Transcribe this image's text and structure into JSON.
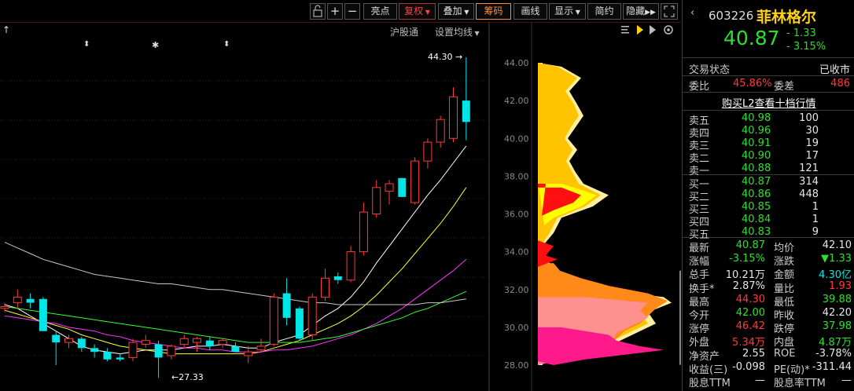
{
  "toolbar": {
    "liangdian": "亮点",
    "fuquan": "复权",
    "diejia": "叠加",
    "chouma": "筹码",
    "huaxian": "画线",
    "xianshi": "显示",
    "jianyue": "简约",
    "yincang": "隐藏"
  },
  "subbar": {
    "hugutong": "沪股通",
    "junxian": "设置均线"
  },
  "chart": {
    "high_label": "44.30",
    "low_label": "27.33",
    "yticks": [
      "44.00",
      "42.00",
      "40.00",
      "38.00",
      "36.00",
      "34.00",
      "32.00",
      "30.00",
      "28.00"
    ]
  },
  "chart_data": {
    "type": "candlestick",
    "price_axis": [
      28,
      44
    ],
    "candles": [
      {
        "o": 31.0,
        "h": 31.3,
        "l": 30.8,
        "c": 31.1
      },
      {
        "o": 31.3,
        "h": 32.0,
        "l": 31.0,
        "c": 31.6
      },
      {
        "o": 31.5,
        "h": 31.8,
        "l": 31.0,
        "c": 31.3
      },
      {
        "o": 31.5,
        "h": 31.6,
        "l": 29.8,
        "c": 29.8
      },
      {
        "o": 29.6,
        "h": 29.8,
        "l": 28.0,
        "c": 29.2
      },
      {
        "o": 29.2,
        "h": 29.6,
        "l": 28.9,
        "c": 29.4
      },
      {
        "o": 29.4,
        "h": 29.5,
        "l": 28.7,
        "c": 28.9
      },
      {
        "o": 28.9,
        "h": 29.1,
        "l": 28.4,
        "c": 28.7
      },
      {
        "o": 28.7,
        "h": 28.9,
        "l": 28.2,
        "c": 28.3
      },
      {
        "o": 28.4,
        "h": 28.6,
        "l": 28.2,
        "c": 28.3
      },
      {
        "o": 28.4,
        "h": 29.4,
        "l": 28.2,
        "c": 29.2
      },
      {
        "o": 29.1,
        "h": 29.6,
        "l": 28.9,
        "c": 29.3
      },
      {
        "o": 29.1,
        "h": 29.3,
        "l": 27.33,
        "c": 28.4
      },
      {
        "o": 28.5,
        "h": 29.1,
        "l": 28.3,
        "c": 29.0
      },
      {
        "o": 29.1,
        "h": 29.6,
        "l": 28.9,
        "c": 29.4
      },
      {
        "o": 29.2,
        "h": 29.5,
        "l": 28.7,
        "c": 29.4
      },
      {
        "o": 29.3,
        "h": 29.5,
        "l": 28.8,
        "c": 29.0
      },
      {
        "o": 29.1,
        "h": 29.4,
        "l": 28.9,
        "c": 29.3
      },
      {
        "o": 29.0,
        "h": 29.2,
        "l": 28.7,
        "c": 28.7
      },
      {
        "o": 28.5,
        "h": 29.0,
        "l": 28.1,
        "c": 28.7
      },
      {
        "o": 28.8,
        "h": 29.4,
        "l": 28.7,
        "c": 29.0
      },
      {
        "o": 29.1,
        "h": 31.8,
        "l": 29.0,
        "c": 31.6
      },
      {
        "o": 31.8,
        "h": 32.6,
        "l": 30.1,
        "c": 30.5
      },
      {
        "o": 31.0,
        "h": 31.1,
        "l": 29.3,
        "c": 29.4
      },
      {
        "o": 29.6,
        "h": 31.8,
        "l": 29.3,
        "c": 31.6
      },
      {
        "o": 31.6,
        "h": 33.1,
        "l": 31.4,
        "c": 32.6
      },
      {
        "o": 32.7,
        "h": 32.9,
        "l": 32.3,
        "c": 32.5
      },
      {
        "o": 32.5,
        "h": 34.3,
        "l": 32.4,
        "c": 34.0
      },
      {
        "o": 34.0,
        "h": 36.6,
        "l": 33.8,
        "c": 36.1
      },
      {
        "o": 36.0,
        "h": 37.8,
        "l": 35.8,
        "c": 37.4
      },
      {
        "o": 37.2,
        "h": 37.8,
        "l": 36.5,
        "c": 37.6
      },
      {
        "o": 37.9,
        "h": 37.9,
        "l": 36.9,
        "c": 36.9
      },
      {
        "o": 36.6,
        "h": 39.0,
        "l": 36.5,
        "c": 38.8
      },
      {
        "o": 38.8,
        "h": 40.0,
        "l": 38.4,
        "c": 39.8
      },
      {
        "o": 39.8,
        "h": 41.2,
        "l": 39.5,
        "c": 41.0
      },
      {
        "o": 40.0,
        "h": 42.7,
        "l": 39.8,
        "c": 42.2
      },
      {
        "o": 42.0,
        "h": 44.3,
        "l": 39.9,
        "c": 40.87
      }
    ],
    "ma_lines": [
      {
        "color": "#ffffff",
        "values": [
          31.2,
          31.0,
          30.6,
          30.2,
          29.8,
          29.4,
          29.0,
          28.8,
          28.7,
          28.6,
          28.7,
          28.8,
          28.8,
          28.8,
          28.9,
          29.0,
          29.0,
          29.1,
          29.0,
          28.9,
          28.9,
          29.2,
          29.4,
          29.6,
          30.1,
          30.6,
          31.0,
          31.6,
          32.4,
          33.4,
          34.3,
          35.2,
          36.1,
          37.0,
          37.8,
          38.7,
          39.6
        ]
      },
      {
        "color": "#ffff33",
        "values": [
          30.9,
          30.7,
          30.5,
          30.3,
          30.1,
          29.9,
          29.6,
          29.4,
          29.2,
          29.0,
          28.9,
          28.8,
          28.7,
          28.6,
          28.6,
          28.6,
          28.6,
          28.6,
          28.6,
          28.6,
          28.7,
          28.9,
          29.1,
          29.3,
          29.6,
          29.9,
          30.2,
          30.6,
          31.1,
          31.7,
          32.4,
          33.1,
          33.9,
          34.7,
          35.5,
          36.4,
          37.4
        ]
      },
      {
        "color": "#ff33ff",
        "values": [
          30.6,
          30.5,
          30.4,
          30.3,
          30.2,
          30.0,
          29.9,
          29.8,
          29.6,
          29.5,
          29.3,
          29.2,
          29.1,
          29.0,
          28.9,
          28.9,
          28.8,
          28.8,
          28.7,
          28.7,
          28.7,
          28.8,
          28.8,
          28.9,
          29.0,
          29.2,
          29.4,
          29.6,
          29.9,
          30.2,
          30.6,
          31.0,
          31.5,
          32.0,
          32.5,
          33.0,
          33.6
        ]
      },
      {
        "color": "#33ff33",
        "values": [
          31.1,
          31.0,
          30.9,
          30.8,
          30.7,
          30.6,
          30.5,
          30.4,
          30.3,
          30.2,
          30.1,
          30.0,
          29.9,
          29.8,
          29.7,
          29.6,
          29.5,
          29.4,
          29.3,
          29.2,
          29.2,
          29.2,
          29.2,
          29.2,
          29.3,
          29.4,
          29.5,
          29.7,
          29.9,
          30.1,
          30.3,
          30.5,
          30.8,
          31.0,
          31.3,
          31.6,
          31.9
        ]
      },
      {
        "color": "#c8c8c8",
        "values": [
          34.5,
          34.2,
          33.9,
          33.6,
          33.4,
          33.2,
          33.0,
          32.8,
          32.7,
          32.6,
          32.5,
          32.4,
          32.3,
          32.3,
          32.2,
          32.1,
          32.0,
          32.0,
          31.9,
          31.8,
          31.7,
          31.6,
          31.5,
          31.4,
          31.3,
          31.3,
          31.2,
          31.2,
          31.2,
          31.2,
          31.2,
          31.2,
          31.2,
          31.3,
          31.3,
          31.4,
          31.5
        ]
      }
    ]
  },
  "quote": {
    "code": "603226",
    "name": "菲林格尔",
    "price": "40.87",
    "change": "- 1.33",
    "change_pct": "- 3.15%",
    "status_label": "交易状态",
    "status_value": "已收市",
    "weibi_label": "委比",
    "weibi_value": "45.86%",
    "weicha_label": "委差",
    "weicha_value": "486",
    "l2_link": "购买L2查看十档行情",
    "asks": [
      {
        "label": "卖五",
        "price": "40.98",
        "vol": "100"
      },
      {
        "label": "卖四",
        "price": "40.96",
        "vol": "30"
      },
      {
        "label": "卖三",
        "price": "40.91",
        "vol": "19"
      },
      {
        "label": "卖二",
        "price": "40.90",
        "vol": "17"
      },
      {
        "label": "卖一",
        "price": "40.88",
        "vol": "121"
      }
    ],
    "bids": [
      {
        "label": "买一",
        "price": "40.87",
        "vol": "314"
      },
      {
        "label": "买二",
        "price": "40.86",
        "vol": "448"
      },
      {
        "label": "买三",
        "price": "40.85",
        "vol": "1"
      },
      {
        "label": "买四",
        "price": "40.84",
        "vol": "1"
      },
      {
        "label": "买五",
        "price": "40.83",
        "vol": "9"
      }
    ],
    "stats": [
      {
        "l1": "最新",
        "v1": "40.87",
        "c1": "dn",
        "l2": "均价",
        "v2": "42.10",
        "c2": "wh"
      },
      {
        "l1": "涨幅",
        "v1": "-3.15%",
        "c1": "dn",
        "l2": "涨跌",
        "v2": "▼1.33",
        "c2": "dn"
      },
      {
        "l1": "总手",
        "v1": "10.21万",
        "c1": "wh",
        "l2": "金额",
        "v2": "4.30亿",
        "c2": "cy"
      },
      {
        "l1": "换手*",
        "v1": "2.87%",
        "c1": "wh",
        "l2": "量比",
        "v2": "1.93",
        "c2": "up"
      },
      {
        "l1": "最高",
        "v1": "44.30",
        "c1": "up",
        "l2": "最低",
        "v2": "39.88",
        "c2": "dn"
      },
      {
        "l1": "今开",
        "v1": "42.00",
        "c1": "dn",
        "l2": "昨收",
        "v2": "42.20",
        "c2": "wh"
      },
      {
        "l1": "涨停",
        "v1": "46.42",
        "c1": "up",
        "l2": "跌停",
        "v2": "37.98",
        "c2": "dn"
      },
      {
        "l1": "外盘",
        "v1": "5.34万",
        "c1": "up",
        "l2": "内盘",
        "v2": "4.87万",
        "c2": "dn"
      },
      {
        "l1": "净资产",
        "v1": "2.55",
        "c1": "wh",
        "l2": "ROE",
        "v2": "-3.78%",
        "c2": "wh"
      },
      {
        "l1": "收益(三)",
        "v1": "-0.098",
        "c1": "wh",
        "l2": "PE(动)*",
        "v2": "-311.44",
        "c2": "wh"
      },
      {
        "l1": "股息TTM",
        "v1": "—",
        "c1": "wh",
        "l2": "股息率TTM",
        "v2": "—",
        "c2": "wh"
      }
    ]
  },
  "colors": {
    "up": "#ff3b3b",
    "down": "#2de02d",
    "cyan": "#00e5e5",
    "accent": "#ff8c3a"
  }
}
